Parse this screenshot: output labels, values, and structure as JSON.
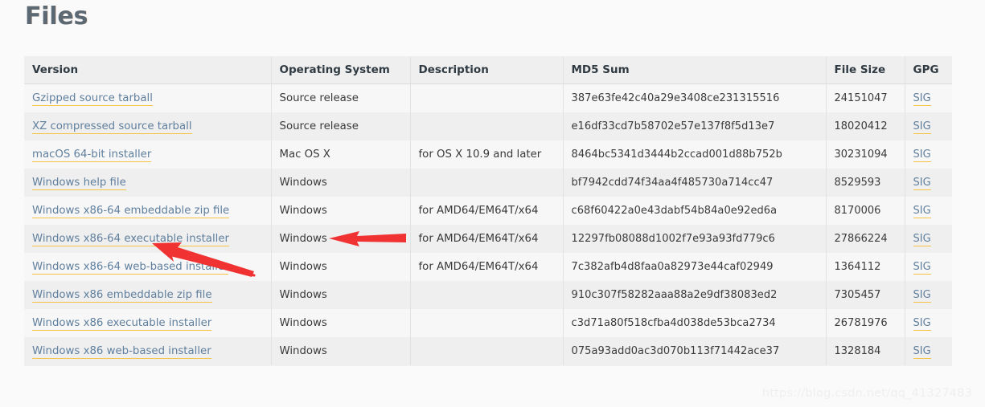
{
  "page": {
    "title": "Files",
    "watermark": "https://blog.csdn.net/qq_41327483",
    "background_color": "#fafafa",
    "link_color": "#5f7f9e",
    "link_underline_color": "#f5c242",
    "heading_color": "#5c6872",
    "annotation_color": "#f03232"
  },
  "table": {
    "headers": [
      "Version",
      "Operating System",
      "Description",
      "MD5 Sum",
      "File Size",
      "GPG"
    ],
    "rows": [
      {
        "version": "Gzipped source tarball",
        "os": "Source release",
        "description": "",
        "md5": "387e63fe42c40a29e3408ce231315516",
        "size": "24151047",
        "gpg": "SIG"
      },
      {
        "version": "XZ compressed source tarball",
        "os": "Source release",
        "description": "",
        "md5": "e16df33cd7b58702e57e137f8f5d13e7",
        "size": "18020412",
        "gpg": "SIG"
      },
      {
        "version": "macOS 64-bit installer",
        "os": "Mac OS X",
        "description": "for OS X 10.9 and later",
        "md5": "8464bc5341d3444b2ccad001d88b752b",
        "size": "30231094",
        "gpg": "SIG"
      },
      {
        "version": "Windows help file",
        "os": "Windows",
        "description": "",
        "md5": "bf7942cdd74f34aa4f485730a714cc47",
        "size": "8529593",
        "gpg": "SIG"
      },
      {
        "version": "Windows x86-64 embeddable zip file",
        "os": "Windows",
        "description": "for AMD64/EM64T/x64",
        "md5": "c68f60422a0e43dabf54b84a0e92ed6a",
        "size": "8170006",
        "gpg": "SIG"
      },
      {
        "version": "Windows x86-64 executable installer",
        "os": "Windows",
        "description": "for AMD64/EM64T/x64",
        "md5": "12297fb08088d1002f7e93a93fd779c6",
        "size": "27866224",
        "gpg": "SIG"
      },
      {
        "version": "Windows x86-64 web-based installer",
        "os": "Windows",
        "description": "for AMD64/EM64T/x64",
        "md5": "7c382afb4d8faa0a82973e44caf02949",
        "size": "1364112",
        "gpg": "SIG"
      },
      {
        "version": "Windows x86 embeddable zip file",
        "os": "Windows",
        "description": "",
        "md5": "910c307f58282aaa88a2e9df38083ed2",
        "size": "7305457",
        "gpg": "SIG"
      },
      {
        "version": "Windows x86 executable installer",
        "os": "Windows",
        "description": "",
        "md5": "c3d71a80f518cfba4d038de53bca2734",
        "size": "26781976",
        "gpg": "SIG"
      },
      {
        "version": "Windows x86 web-based installer",
        "os": "Windows",
        "description": "",
        "md5": "075a93add0ac3d070b113f71442ace37",
        "size": "1328184",
        "gpg": "SIG"
      }
    ]
  },
  "annotations": [
    {
      "name": "arrow-to-operating-system",
      "shape": "left-pointing-arrow",
      "color": "#f03232"
    },
    {
      "name": "arrow-to-windows-x86-64-executable-installer",
      "shape": "diagonal-left-up-arrow",
      "color": "#f03232"
    }
  ]
}
